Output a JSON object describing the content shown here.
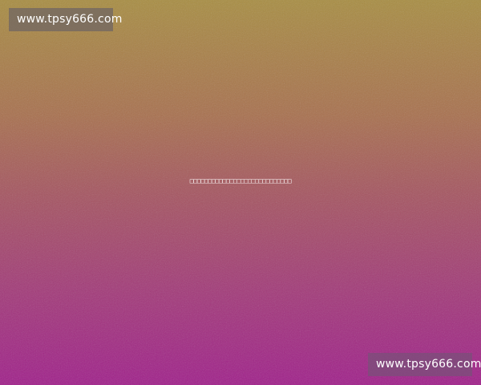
{
  "watermarks": {
    "top_left": "www.tpsy666.com",
    "bottom_right": "www.tpsy666.com"
  },
  "center_text": "□□□□□□□□□□□□□□□□□□□□□□□□□□□□",
  "colors": {
    "gradient_top": "#a88d42",
    "gradient_middle": "#a55560",
    "gradient_bottom": "#a01f8a"
  }
}
